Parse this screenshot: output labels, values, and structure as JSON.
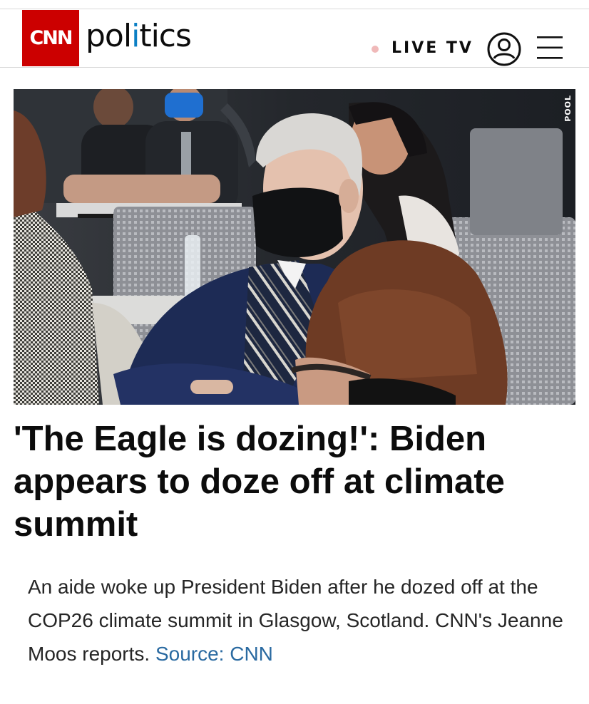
{
  "header": {
    "logo_text": "CNN",
    "section_prefix": "pol",
    "section_accent": "i",
    "section_suffix": "tics",
    "live_label": "LIVE TV",
    "brand_color": "#cc0000",
    "accent_color": "#0b7fc4"
  },
  "hero": {
    "watermark": "POOL",
    "icons": [
      "account-icon",
      "menu-icon"
    ]
  },
  "article": {
    "headline": "'The Eagle is dozing!': Biden appears to doze off at climate summit",
    "description": "An aide woke up President Biden after he dozed off at the COP26 climate summit in Glasgow, Scotland. CNN's Jeanne Moos reports.",
    "source_link": "Source: CNN",
    "link_color": "#2a6aa1"
  }
}
